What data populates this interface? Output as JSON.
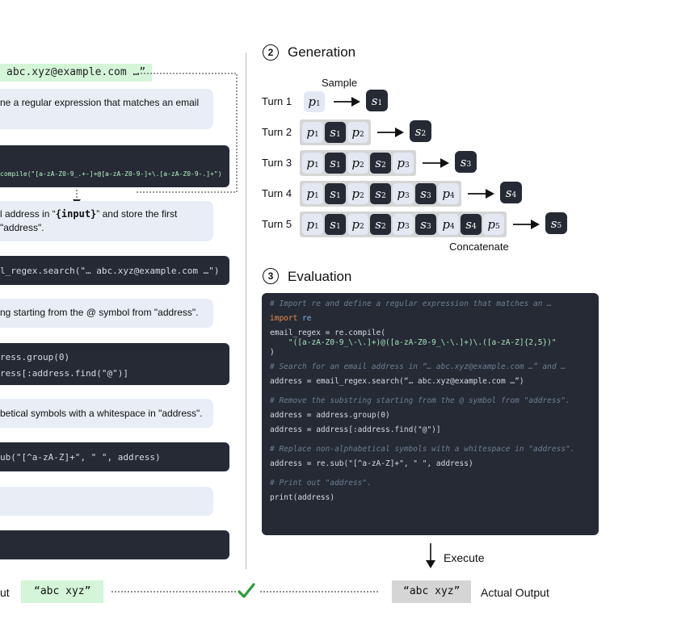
{
  "left": {
    "input_chip": "abc.xyz@example.com …”",
    "steps": [
      {
        "text": "ne a regular expression that matches an email"
      },
      {
        "code": "compile(\"[a-zA-Z0-9_.+-]+@[a-zA-Z0-9-]+\\.[a-zA-Z0-9-.]+\")"
      },
      {
        "text_a": "l address in “",
        "input_token": "{input}",
        "text_b": "” and store the first",
        "text_line2": "\"address\"."
      },
      {
        "code": "l_regex.search(\"… abc.xyz@example.com …\")"
      },
      {
        "text": "ng starting from the @ symbol from \"address\"."
      },
      {
        "code_l1": "ress.group(0)",
        "code_l2": "ress[:address.find(\"@\")]"
      },
      {
        "text": "betical symbols with a whitespace in \"address\"."
      },
      {
        "code": "ub(\"[^a-zA-Z]+\", \" \", address)"
      },
      {
        "text": ""
      },
      {
        "code": ""
      }
    ]
  },
  "generation": {
    "number": "2",
    "title": "Generation",
    "sample_label": "Sample",
    "concatenate_label": "Concatenate",
    "turns": [
      {
        "label": "Turn 1",
        "n": 1
      },
      {
        "label": "Turn 2",
        "n": 2
      },
      {
        "label": "Turn 3",
        "n": 3
      },
      {
        "label": "Turn 4",
        "n": 4
      },
      {
        "label": "Turn 5",
        "n": 5
      }
    ]
  },
  "evaluation": {
    "number": "3",
    "title": "Evaluation",
    "code": [
      {
        "t": "cm",
        "v": "# Import re and define a regular expression that matches an …"
      },
      {
        "t": "blank"
      },
      {
        "t": "import",
        "kw": "import",
        "rest": " re"
      },
      {
        "t": "blank"
      },
      {
        "t": "raw",
        "v": "email_regex = re.compile("
      },
      {
        "t": "str",
        "v": "    \"([a-zA-Z0-9_\\-\\.]+)@([a-zA-Z0-9_\\-\\.]+)\\.([a-zA-Z]{2,5})\""
      },
      {
        "t": "raw",
        "v": ")"
      },
      {
        "t": "blank"
      },
      {
        "t": "cm",
        "v": "# Search for an email address in “… abc.xyz@example.com …” and …"
      },
      {
        "t": "blank"
      },
      {
        "t": "raw",
        "v": "address = email_regex.search(“… abc.xyz@example.com …”)"
      },
      {
        "t": "blank"
      },
      {
        "t": "blank"
      },
      {
        "t": "cm",
        "v": "# Remove the substring starting from the @ symbol from \"address\"."
      },
      {
        "t": "blank"
      },
      {
        "t": "raw",
        "v": "address = address.group(0)"
      },
      {
        "t": "blank"
      },
      {
        "t": "raw",
        "v": "address = address[:address.find(\"@\")]"
      },
      {
        "t": "blank"
      },
      {
        "t": "blank"
      },
      {
        "t": "cm",
        "v": "# Replace non-alphabetical symbols with a whitespace in \"address\"."
      },
      {
        "t": "blank"
      },
      {
        "t": "raw",
        "v": "address = re.sub(\"[^a-zA-Z]+\", \" \", address)"
      },
      {
        "t": "blank"
      },
      {
        "t": "blank"
      },
      {
        "t": "cm",
        "v": "# Print out \"address\"."
      },
      {
        "t": "blank"
      },
      {
        "t": "raw",
        "v": "print(address)"
      }
    ],
    "execute_label": "Execute"
  },
  "bottom": {
    "expected_label_partial": "ut",
    "expected_value": "“abc xyz”",
    "check_icon": "check-icon",
    "actual_value": "“abc xyz”",
    "actual_label": "Actual Output"
  },
  "colors": {
    "code_bg": "#252a35",
    "bubble_bg": "#e8edf6",
    "match_green": "#d4f5d8",
    "check_green": "#2e9b3a",
    "token_p": "#e3e8f3",
    "token_s": "#252a35"
  }
}
